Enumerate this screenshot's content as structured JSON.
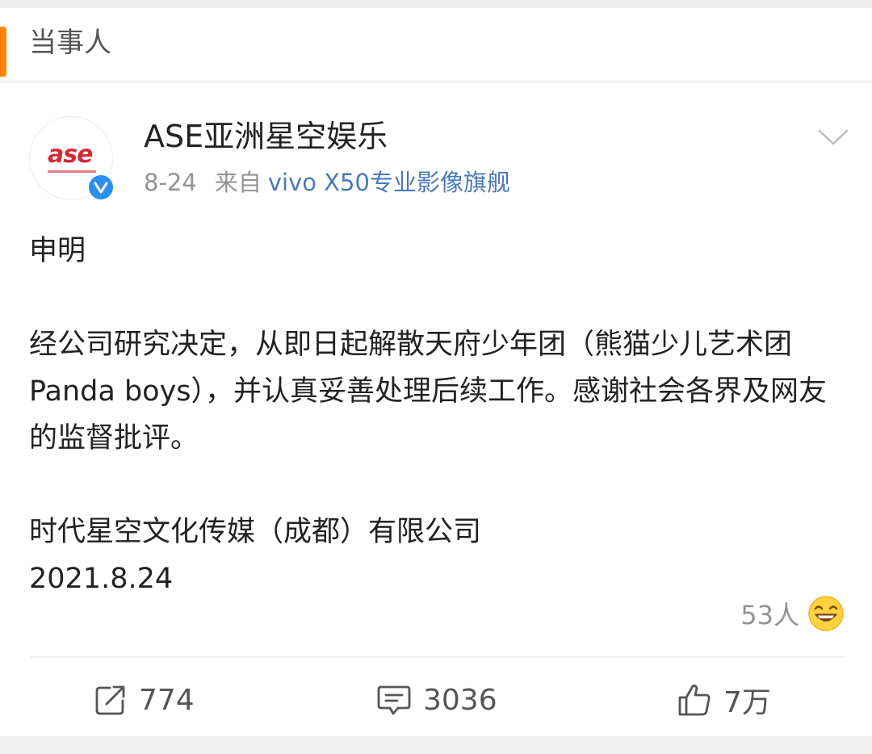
{
  "section": {
    "title": "当事人"
  },
  "post": {
    "author": {
      "name": "ASE亚洲星空娱乐",
      "avatar_logo": "ase",
      "verified": true
    },
    "date": "8-24",
    "source_prefix": "来自",
    "device": "vivo X50专业影像旗舰",
    "body": {
      "heading": "申明",
      "paragraph": "经公司研究决定，从即日起解散天府少年团（熊猫少儿艺术团Panda boys），并认真妥善处理后续工作。感谢社会各界及网友的监督批评。",
      "signature": "时代星空文化传媒（成都）有限公司",
      "signed_date": "2021.8.24"
    },
    "reactions": {
      "count": "53人",
      "icon": "laughing-face-icon"
    },
    "actions": {
      "repost": "774",
      "comment": "3036",
      "like": "7万"
    }
  },
  "colors": {
    "accent": "#ff8200",
    "link": "#4b7ab8",
    "verified": "#2a8ef0",
    "muted": "#939393"
  }
}
